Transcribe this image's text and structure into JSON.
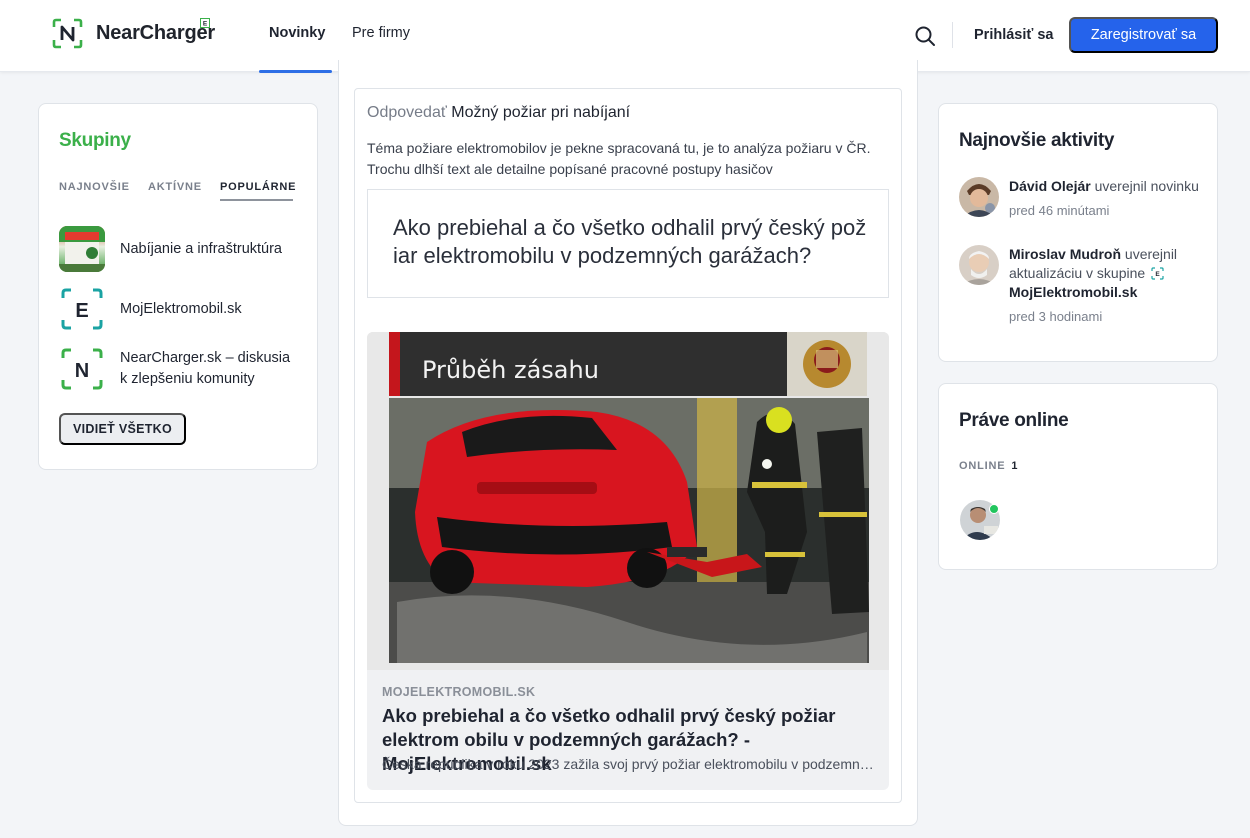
{
  "header": {
    "brand": "NearCharger",
    "nav": [
      "Novinky",
      "Pre firmy"
    ],
    "login": "Prihlásiť sa",
    "register": "Zaregistrovať sa"
  },
  "groups": {
    "title": "Skupiny",
    "tabs": [
      "NAJNOVŠIE",
      "AKTÍVNE",
      "POPULÁRNE"
    ],
    "active_tab": "POPULÁRNE",
    "items": [
      {
        "name": "Nabíjanie a infraštruktúra"
      },
      {
        "name": "MojElektromobil.sk",
        "logo_letter": "E"
      },
      {
        "name": "NearCharger.sk – diskusia k zlepšeniu komunity",
        "logo_letter": "N"
      }
    ],
    "see_all": "VIDIEŤ VŠETKO"
  },
  "post": {
    "reply_prefix": "Odpovedať",
    "reply_title": "Možný požiar pri nabíjaní",
    "text": "Téma požiare elektromobilov je pekne spracovaná tu, je to analýza požiaru v ČR. Trochu dlhší text ale detailne popísané pracovné postupy hasičov",
    "quote_title": "Ako prebiehal a čo všetko odhalil prvý český pož iar elektromobilu v podzemných garážach?",
    "link": {
      "image_caption": "Průběh zásahu",
      "domain": "MOJELEKTROMOBIL.SK",
      "title": "Ako prebiehal a čo všetko odhalil prvý český požiar elektrom obilu v podzemných garážach? - MojElektromobil.sk",
      "description": "Česká republika v roku 2023 zažila svoj prvý požiar elektromobilu v podzemných garážach"
    }
  },
  "activities": {
    "title": "Najnovšie aktivity",
    "items": [
      {
        "user": "Dávid Olejár",
        "action": "uverejnil novinku",
        "group": "",
        "time": "pred 46 minútami"
      },
      {
        "user": "Miroslav Mudroň",
        "action": "uverejnil aktualizáciu v skupine",
        "group": "MojElektromobil.sk",
        "time": "pred 3 hodinami"
      }
    ]
  },
  "online": {
    "title": "Práve online",
    "label": "ONLINE",
    "count": "1"
  },
  "colors": {
    "brand_green": "#3bb04a",
    "primary_blue": "#2563eb",
    "teal": "#1aa3a3"
  }
}
